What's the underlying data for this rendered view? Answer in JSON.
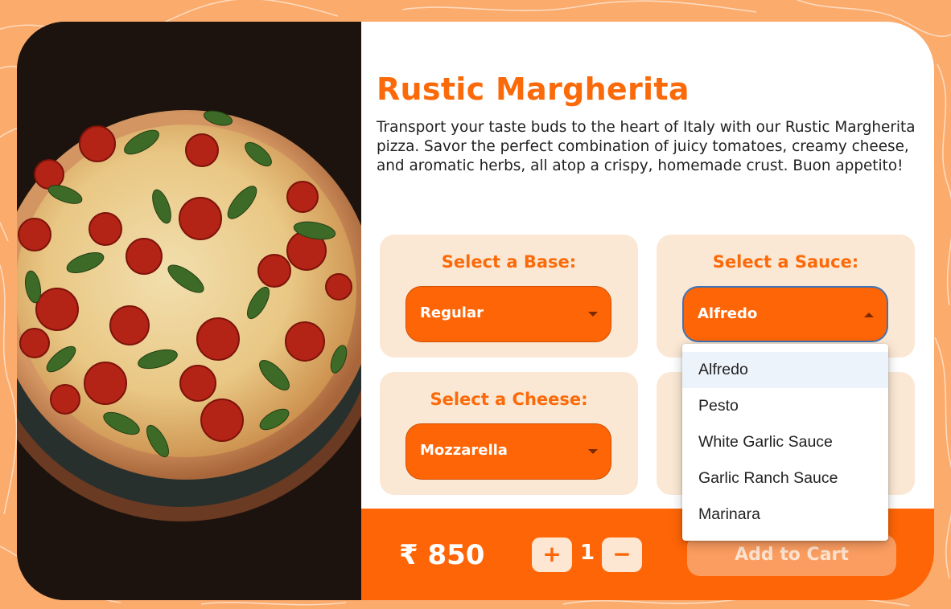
{
  "product": {
    "title": "Rustic Margherita",
    "description": "Transport your taste buds to the heart of Italy with our Rustic Margherita pizza. Savor the perfect combination of juicy tomatoes, creamy cheese, and aromatic herbs, all atop a crispy, homemade crust. Buon appetito!",
    "image_icon": "pizza-photo"
  },
  "options": {
    "base": {
      "label": "Select a Base:",
      "value": "Regular"
    },
    "sauce": {
      "label": "Select a Sauce:",
      "value": "Alfredo"
    },
    "cheese": {
      "label": "Select a Cheese:",
      "value": "Mozzarella"
    }
  },
  "sauce_dropdown": {
    "options": [
      "Alfredo",
      "Pesto",
      "White Garlic Sauce",
      "Garlic Ranch Sauce",
      "Marinara"
    ],
    "highlighted": "Alfredo"
  },
  "footer": {
    "price": "₹ 850",
    "quantity": "1",
    "plus_label": "+",
    "minus_label": "−",
    "add_to_cart_label": "Add to Cart"
  },
  "colors": {
    "accent": "#fe6506",
    "option_card_bg": "#fbe8d4",
    "page_bg": "#fbab6c",
    "focus_ring": "#3f73b5"
  }
}
